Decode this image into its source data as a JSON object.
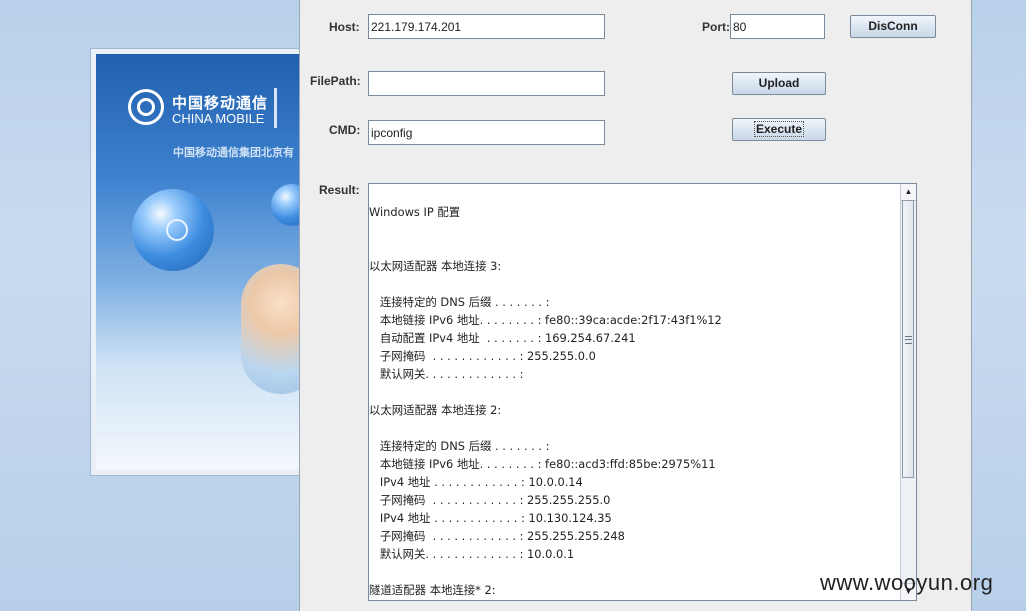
{
  "background": {
    "logo_cn": "中国移动通信",
    "logo_en": "CHINA MOBILE",
    "subtitle": "中国移动通信集团北京有"
  },
  "form": {
    "host_label": "Host:",
    "host_value": "221.179.174.201",
    "port_label": "Port:",
    "port_value": "80",
    "disconnect_label": "DisConn",
    "filepath_label": "FilePath:",
    "filepath_value": "",
    "upload_label": "Upload",
    "cmd_label": "CMD:",
    "cmd_value": "ipconfig",
    "execute_label": "Execute",
    "result_label": "Result:"
  },
  "result": {
    "lines": [
      "Windows IP 配置",
      "",
      "",
      "以太网适配器 本地连接 3:",
      "",
      "   连接特定的 DNS 后缀 . . . . . . . :",
      "   本地链接 IPv6 地址. . . . . . . . : fe80::39ca:acde:2f17:43f1%12",
      "   自动配置 IPv4 地址  . . . . . . . : 169.254.67.241",
      "   子网掩码  . . . . . . . . . . . . : 255.255.0.0",
      "   默认网关. . . . . . . . . . . . . :",
      "",
      "以太网适配器 本地连接 2:",
      "",
      "   连接特定的 DNS 后缀 . . . . . . . :",
      "   本地链接 IPv6 地址. . . . . . . . : fe80::acd3:ffd:85be:2975%11",
      "   IPv4 地址 . . . . . . . . . . . . : 10.0.0.14",
      "   子网掩码  . . . . . . . . . . . . : 255.255.255.0",
      "   IPv4 地址 . . . . . . . . . . . . : 10.130.124.35",
      "   子网掩码  . . . . . . . . . . . . : 255.255.255.248",
      "   默认网关. . . . . . . . . . . . . : 10.0.0.1",
      "",
      "隧道适配器 本地连接* 2:"
    ]
  },
  "watermark": "www.wooyun.org",
  "icons": {
    "scroll_up": "scroll-up-arrow-icon",
    "scroll_down": "scroll-down-arrow-icon",
    "grip": "scroll-grip-icon",
    "logo": "china-mobile-logo-icon"
  }
}
